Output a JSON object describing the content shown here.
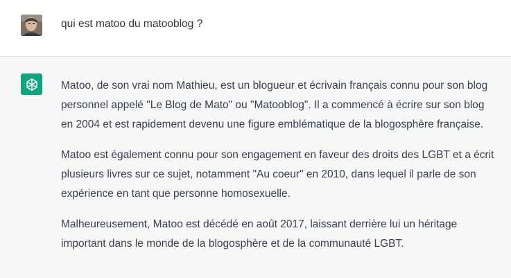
{
  "user_message": {
    "text": "qui est matoo du matooblog ?",
    "avatar_icon": "user-photo-avatar"
  },
  "assistant_message": {
    "avatar_icon": "openai-logo-icon",
    "accent_color": "#10a37f",
    "paragraphs": [
      {
        "lines": [
          "Matoo, de son vrai nom Mathieu, est un blogueur et écrivain français connu pour son blog",
          "personnel appelé \"Le Blog de Mato\" ou \"Matooblog\". Il a commencé à écrire sur son blog",
          "en 2004 et est rapidement devenu une figure emblématique de la blogosphère française."
        ]
      },
      {
        "lines": [
          "Matoo est également connu pour son engagement en faveur des droits des LGBT et a écrit",
          "plusieurs livres sur ce sujet, notamment \"Au coeur\" en 2010, dans lequel il parle de son",
          "expérience en tant que personne homosexuelle."
        ]
      },
      {
        "lines": [
          "Malheureusement, Matoo est décédé en août 2017, laissant derrière lui un héritage",
          "important dans le monde de la blogosphère et de la communauté LGBT."
        ]
      }
    ]
  }
}
